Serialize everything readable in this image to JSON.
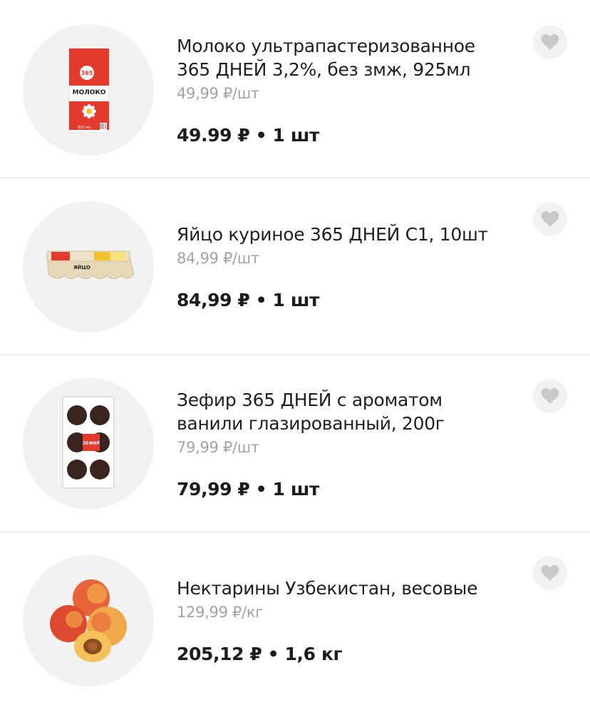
{
  "items": [
    {
      "name": "Молоко ультрапастеризованное\n365 ДНЕЙ 3,2%, без змж, 925мл",
      "unit_price": "49,99 ₽/шт",
      "total": "49.99 ₽ • 1 шт",
      "image_icon": "milk-carton-icon",
      "thumb_text": {
        "brand": "365",
        "title": "МОЛОКО",
        "volume": "925 мл"
      }
    },
    {
      "name": "Яйцо куриное 365 ДНЕЙ С1, 10шт",
      "unit_price": "84,99 ₽/шт",
      "total": "84,99 ₽ • 1 шт",
      "image_icon": "egg-carton-icon",
      "thumb_text": {
        "title": "ЯЙЦО"
      }
    },
    {
      "name": "Зефир 365 ДНЕЙ с ароматом\nванили глазированный, 200г",
      "unit_price": "79,99 ₽/шт",
      "total": "79,99 ₽ • 1 шт",
      "image_icon": "marshmallow-pack-icon",
      "thumb_text": {
        "title": "ЗЕФИР"
      }
    },
    {
      "name": "Нектарины Узбекистан, весовые",
      "unit_price": "129,99 ₽/кг",
      "total": "205,12 ₽ • 1,6 кг",
      "image_icon": "nectarines-icon"
    }
  ],
  "favorite_icon": "heart-icon",
  "colors": {
    "thumb_bg": "#f2f2f2",
    "heart": "#c9c9c9",
    "unit_price": "#a3a3a3",
    "divider": "#eeeeee",
    "brand_red": "#e23b2e"
  }
}
